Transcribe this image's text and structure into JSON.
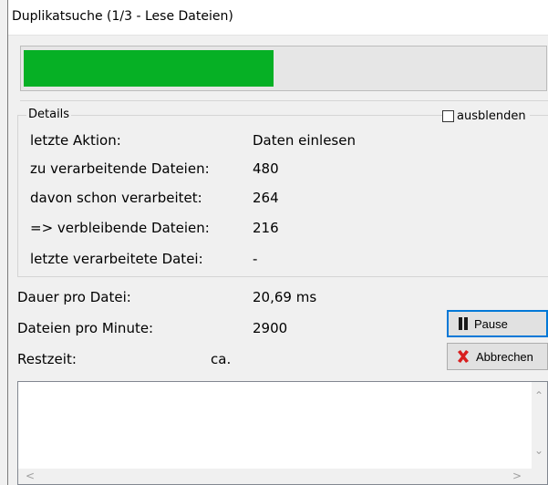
{
  "window": {
    "title": "Duplikatsuche (1/3 - Lese Dateien)"
  },
  "progress": {
    "fraction": 0.48,
    "color": "#06b025"
  },
  "details": {
    "legend": "Details",
    "hide_checkbox": {
      "label": "ausblenden",
      "checked": false
    },
    "rows": [
      {
        "label": "letzte Aktion:",
        "value": "Daten einlesen"
      },
      {
        "label": "zu verarbeitende Dateien:",
        "value": "480"
      },
      {
        "label": "davon schon verarbeitet:",
        "value": "264"
      },
      {
        "label": "=> verbleibende Dateien:",
        "value": "216"
      },
      {
        "label": "letzte verarbeitete Datei:",
        "value": "-"
      }
    ]
  },
  "stats": {
    "rows": [
      {
        "label": "Dauer pro Datei:",
        "value": "20,69 ms"
      },
      {
        "label": "Dateien pro Minute:",
        "value": "2900"
      },
      {
        "label": "Restzeit:",
        "value": "ca."
      }
    ]
  },
  "buttons": {
    "pause": {
      "label": "Pause",
      "icon": "pause-icon"
    },
    "cancel": {
      "label": "Abbrechen",
      "icon": "close-x-icon"
    }
  },
  "log": {
    "text": ""
  }
}
